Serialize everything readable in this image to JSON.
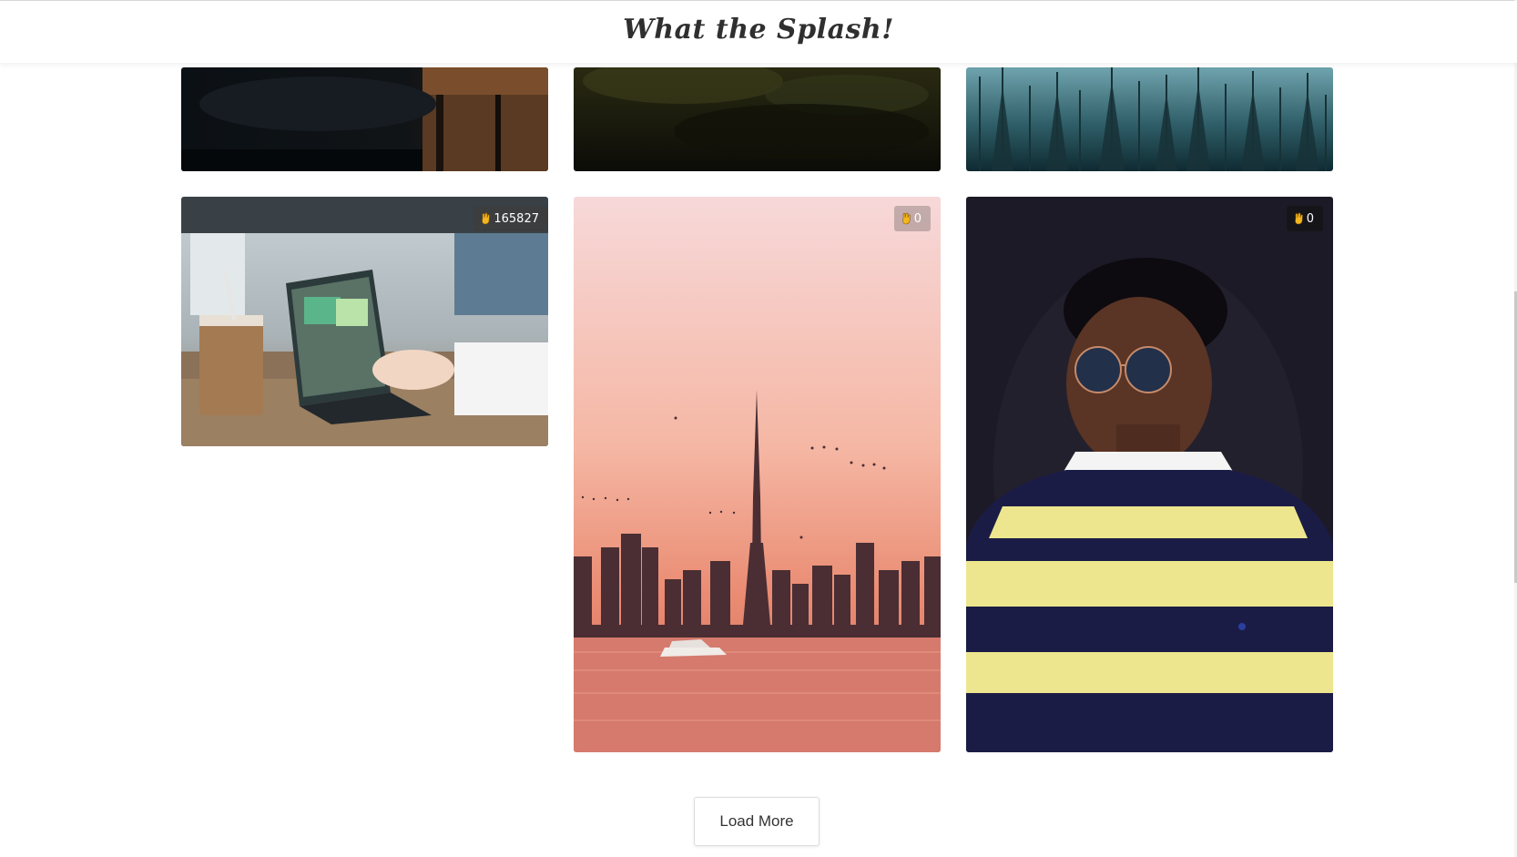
{
  "header": {
    "title": "What the Splash!"
  },
  "photos": {
    "row1": [
      {
        "desc": "dark cafe scene"
      },
      {
        "desc": "dark forest foliage"
      },
      {
        "desc": "misty teal pine forest"
      }
    ],
    "row2": [
      {
        "likes": "165827",
        "desc": "laptop with iced coffee on wooden table",
        "like_icon": "like-hand-icon"
      },
      {
        "likes": "0",
        "desc": "city skyline at sunset with birds and boat",
        "like_icon": "like-hand-icon"
      },
      {
        "likes": "0",
        "desc": "man in sunglasses and striped sweater",
        "like_icon": "like-hand-icon"
      }
    ]
  },
  "load_more": {
    "label": "Load More"
  },
  "colors": {
    "accent_icon": "#f3b61f",
    "badge_bg": "#3c3c3c"
  }
}
